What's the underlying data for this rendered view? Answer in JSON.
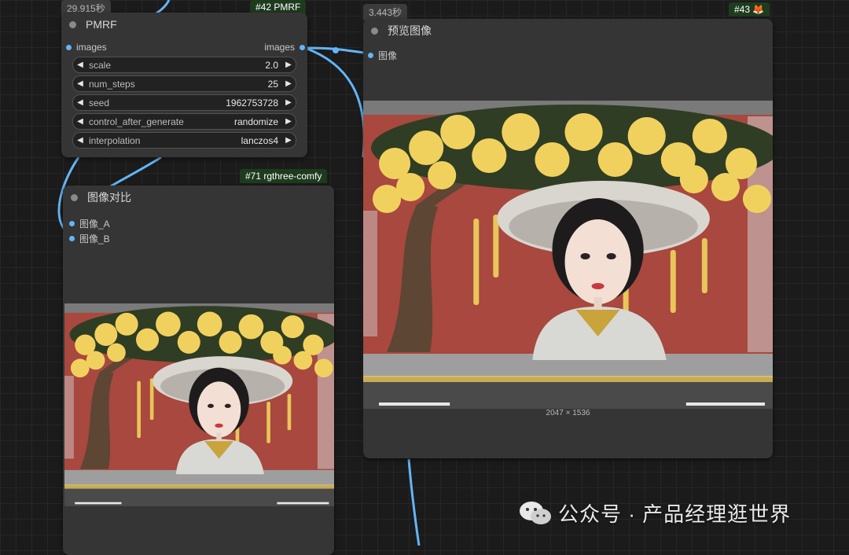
{
  "pmrf_node": {
    "time": "29.915秒",
    "badge": "#42 PMRF",
    "title": "PMRF",
    "input_label": "images",
    "output_label": "images",
    "widgets": [
      {
        "label": "scale",
        "value": "2.0"
      },
      {
        "label": "num_steps",
        "value": "25"
      },
      {
        "label": "seed",
        "value": "1962753728"
      },
      {
        "label": "control_after_generate",
        "value": "randomize"
      },
      {
        "label": "interpolation",
        "value": "lanczos4"
      }
    ]
  },
  "compare_node": {
    "badge": "#71 rgthree-comfy",
    "title": "图像对比",
    "inputs": [
      "图像_A",
      "图像_B"
    ]
  },
  "preview_node": {
    "time": "3.443秒",
    "badge": "#43 🦊",
    "title": "预览图像",
    "input_label": "图像",
    "image_size": "2047 × 1536"
  },
  "watermark": {
    "text": "公众号 · 产品经理逛世界"
  },
  "colors": {
    "link": "#64b5f6",
    "node_bg": "#353535",
    "badge_bg": "#1e3b1e",
    "canvas_bg": "#1b1b1b"
  }
}
